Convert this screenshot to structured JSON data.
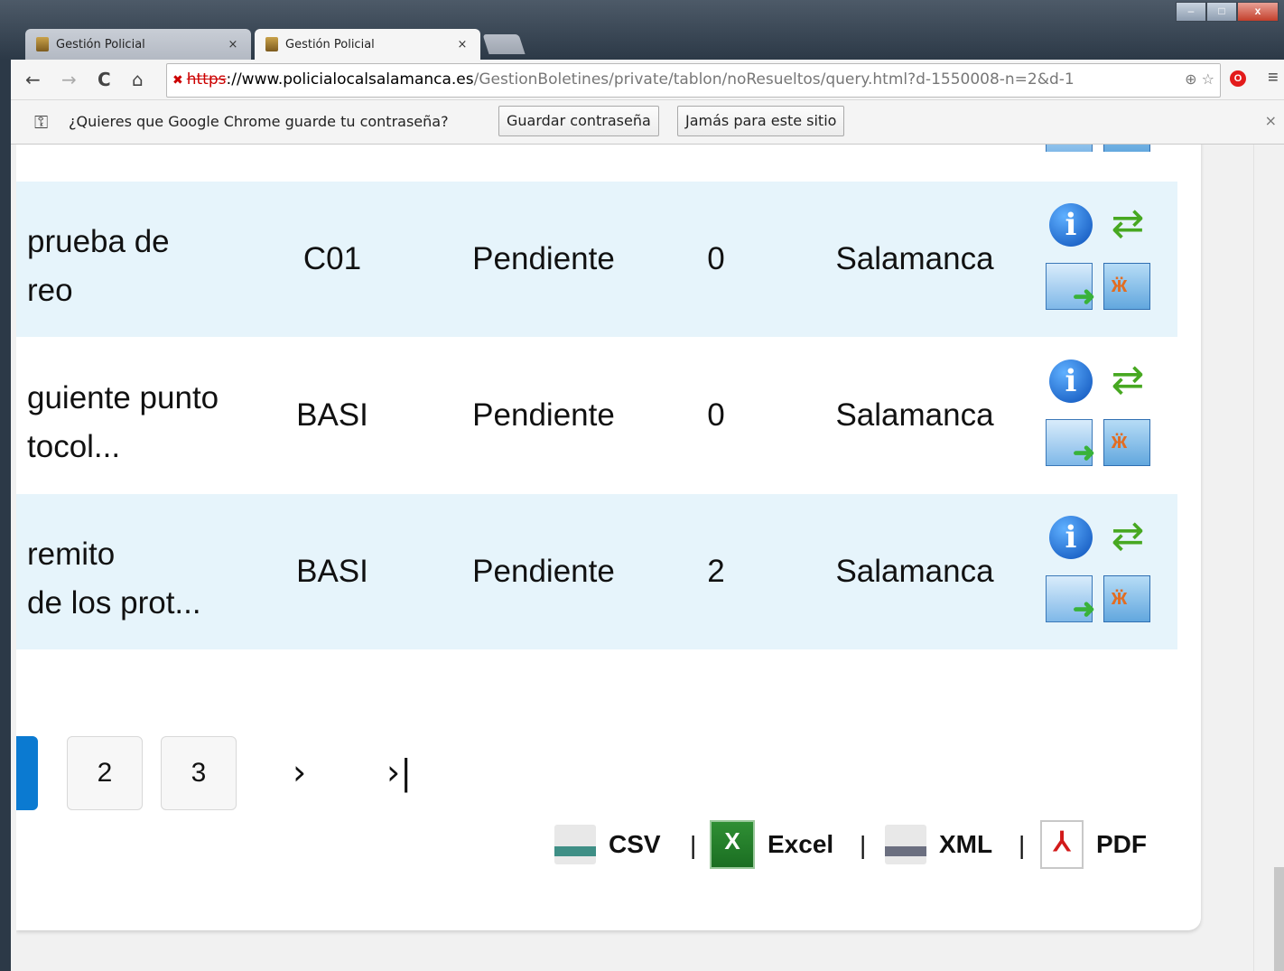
{
  "browser": {
    "tabs": [
      {
        "title": "Gestión Policial",
        "close": "×"
      },
      {
        "title": "Gestión Policial",
        "close": "×"
      }
    ],
    "window_buttons": {
      "minimize": "–",
      "maximize": "□",
      "close": "x"
    },
    "url": {
      "scheme": "https",
      "host": "://www.policialocalsalamanca.es",
      "path": "/GestionBoletines/private/tablon/noResueltos/query.html?d-1550008-n=2&d-1"
    },
    "nav": {
      "back": "←",
      "forward": "→",
      "reload": "C",
      "home": "⌂",
      "menu": "≡",
      "zoom": "⊕",
      "star": "☆"
    },
    "password_bar": {
      "message": "¿Quieres que Google Chrome guarde tu contraseña?",
      "save_label": "Guardar contraseña",
      "never_label": "Jamás para este sitio",
      "close": "×"
    }
  },
  "table": {
    "rows": [
      {
        "desc": "prueba de\nreo",
        "code": "C01",
        "status": "Pendiente",
        "count": "0",
        "city": "Salamanca"
      },
      {
        "desc": "guiente punto\ntocol...",
        "code": "BASI",
        "status": "Pendiente",
        "count": "0",
        "city": "Salamanca"
      },
      {
        "desc": "remito\nde los prot...",
        "code": "BASI",
        "status": "Pendiente",
        "count": "2",
        "city": "Salamanca"
      }
    ],
    "action_icons": [
      "info-icon",
      "refresh-icon",
      "send-mail-icon",
      "assign-users-icon"
    ]
  },
  "pagination": {
    "pages": [
      "2",
      "3"
    ],
    "next": "›",
    "last": "›|"
  },
  "exports": [
    {
      "label": "CSV",
      "icon": "csv-icon"
    },
    {
      "label": "Excel",
      "icon": "excel-icon"
    },
    {
      "label": "XML",
      "icon": "xml-icon"
    },
    {
      "label": "PDF",
      "icon": "pdf-icon"
    }
  ],
  "export_separator": "|",
  "colors": {
    "row_shade": "#e6f4fb",
    "current_page": "#0b7ad1",
    "accent_green": "#47a821"
  }
}
